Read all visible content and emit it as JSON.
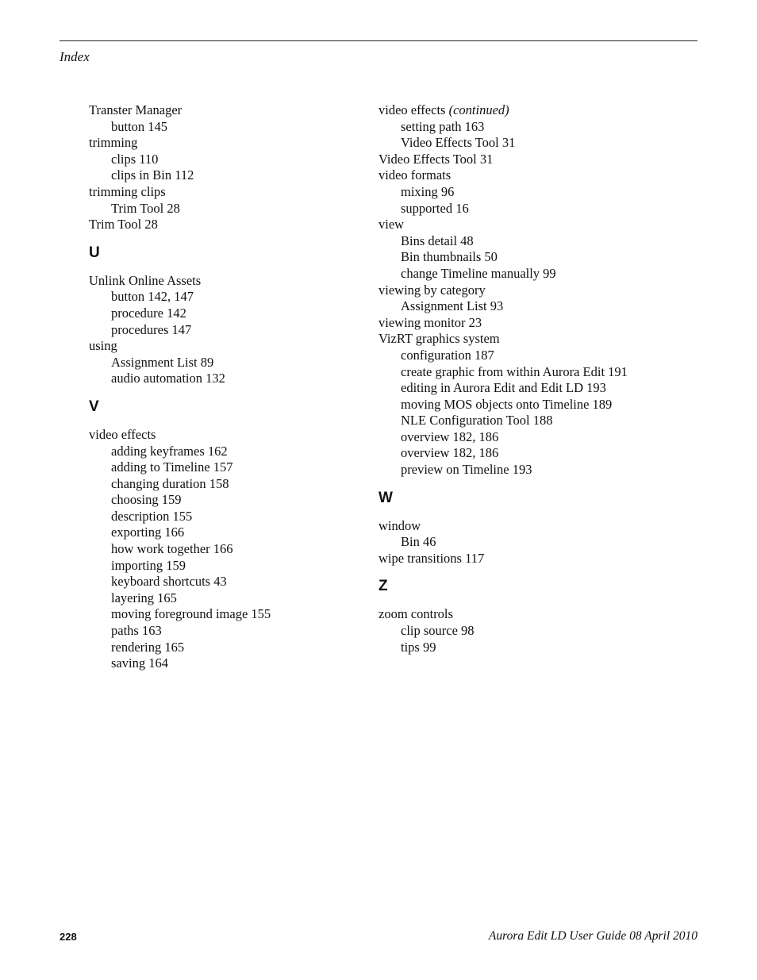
{
  "header": {
    "title": "Index"
  },
  "columns": [
    {
      "sections": [
        {
          "letter": "",
          "entries": [
            {
              "text": "Transter Manager",
              "level": 0
            },
            {
              "text": "button 145",
              "level": 1
            },
            {
              "text": "trimming",
              "level": 0
            },
            {
              "text": "clips 110",
              "level": 1
            },
            {
              "text": "clips in Bin 112",
              "level": 1
            },
            {
              "text": "trimming clips",
              "level": 0
            },
            {
              "text": "Trim Tool 28",
              "level": 1
            },
            {
              "text": "Trim Tool 28",
              "level": 0
            }
          ]
        },
        {
          "letter": "U",
          "entries": [
            {
              "text": "Unlink Online Assets",
              "level": 0
            },
            {
              "text": "button 142, 147",
              "level": 1
            },
            {
              "text": "procedure 142",
              "level": 1
            },
            {
              "text": "procedures 147",
              "level": 1
            },
            {
              "text": "using",
              "level": 0
            },
            {
              "text": "Assignment List 89",
              "level": 1
            },
            {
              "text": "audio automation 132",
              "level": 1
            }
          ]
        },
        {
          "letter": "V",
          "entries": [
            {
              "text": "video effects",
              "level": 0
            },
            {
              "text": "adding keyframes 162",
              "level": 1
            },
            {
              "text": "adding to Timeline 157",
              "level": 1
            },
            {
              "text": "changing duration 158",
              "level": 1
            },
            {
              "text": "choosing 159",
              "level": 1
            },
            {
              "text": "description 155",
              "level": 1
            },
            {
              "text": "exporting 166",
              "level": 1
            },
            {
              "text": "how work together 166",
              "level": 1
            },
            {
              "text": "importing 159",
              "level": 1
            },
            {
              "text": "keyboard shortcuts 43",
              "level": 1
            },
            {
              "text": "layering 165",
              "level": 1
            },
            {
              "text": "moving foreground image 155",
              "level": 1
            },
            {
              "text": "paths 163",
              "level": 1
            },
            {
              "text": "rendering 165",
              "level": 1
            },
            {
              "text": "saving 164",
              "level": 1
            }
          ]
        }
      ]
    },
    {
      "sections": [
        {
          "letter": "",
          "entries": [
            {
              "text": "video effects",
              "suffix": "(continued)",
              "level": 0
            },
            {
              "text": "setting path 163",
              "level": 1
            },
            {
              "text": "Video Effects Tool 31",
              "level": 1
            },
            {
              "text": "Video Effects Tool 31",
              "level": 0
            },
            {
              "text": "video formats",
              "level": 0
            },
            {
              "text": "mixing 96",
              "level": 1
            },
            {
              "text": "supported 16",
              "level": 1
            },
            {
              "text": "view",
              "level": 0
            },
            {
              "text": "Bins detail 48",
              "level": 1
            },
            {
              "text": "Bin thumbnails 50",
              "level": 1
            },
            {
              "text": "change Timeline manually 99",
              "level": 1
            },
            {
              "text": "viewing by category",
              "level": 0
            },
            {
              "text": "Assignment List 93",
              "level": 1
            },
            {
              "text": "viewing monitor 23",
              "level": 0
            },
            {
              "text": "VizRT graphics system",
              "level": 0
            },
            {
              "text": "configuration 187",
              "level": 1
            },
            {
              "text": "create graphic from within Aurora Edit 191",
              "level": 1
            },
            {
              "text": "editing in Aurora Edit and Edit LD 193",
              "level": 1
            },
            {
              "text": "moving MOS objects onto Timeline 189",
              "level": 1
            },
            {
              "text": "NLE Configuration Tool 188",
              "level": 1
            },
            {
              "text": "overview 182, 186",
              "level": 1
            },
            {
              "text": "overview 182, 186",
              "level": 1
            },
            {
              "text": "preview on Timeline 193",
              "level": 1
            }
          ]
        },
        {
          "letter": "W",
          "entries": [
            {
              "text": "window",
              "level": 0
            },
            {
              "text": "Bin 46",
              "level": 1
            },
            {
              "text": "wipe transitions 117",
              "level": 0
            }
          ]
        },
        {
          "letter": "Z",
          "entries": [
            {
              "text": "zoom controls",
              "level": 0
            },
            {
              "text": "clip source 98",
              "level": 1
            },
            {
              "text": "tips 99",
              "level": 1
            }
          ]
        }
      ]
    }
  ],
  "footer": {
    "page_number": "228",
    "doc_title": "Aurora Edit LD User Guide 08 April 2010"
  }
}
